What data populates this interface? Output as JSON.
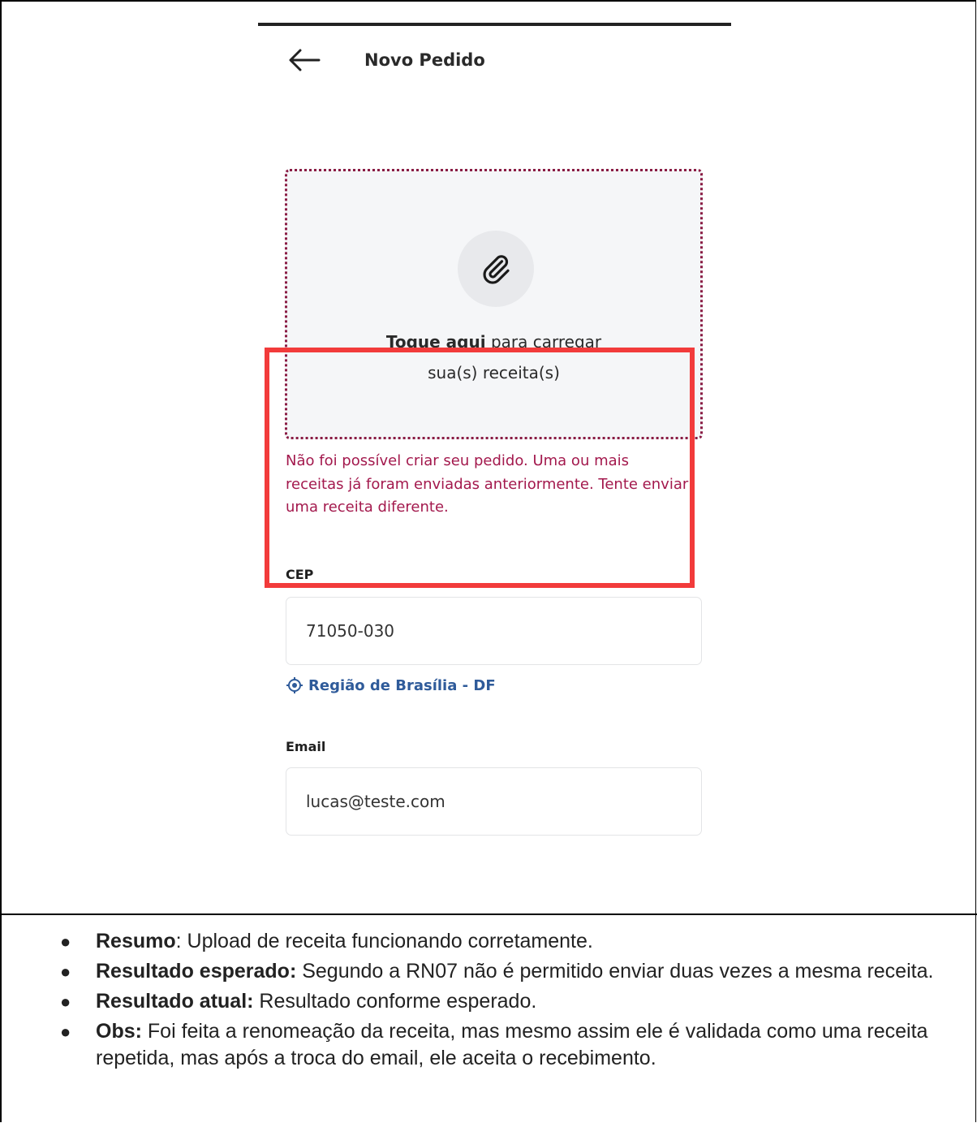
{
  "app": {
    "title": "Novo Pedido",
    "back_label": "Voltar"
  },
  "upload": {
    "bold_text": "Toque aqui",
    "text_part1": " para carregar",
    "text_part2": "sua(s) receita(s)",
    "icon": "paperclip-icon"
  },
  "error": {
    "message": "Não foi possível criar seu pedido. Uma ou mais receitas já foram enviadas anteriormente. Tente enviar uma receita diferente."
  },
  "form": {
    "cep_label": "CEP",
    "cep_value": "71050-030",
    "region_text": "Região de Brasília - DF",
    "email_label": "Email",
    "email_value": "lucas@teste.com"
  },
  "notes": [
    {
      "bold": "Resumo",
      "text": ": Upload de receita funcionando corretamente."
    },
    {
      "bold": "Resultado esperado:",
      "text": " Segundo a RN07 não é permitido enviar duas vezes a mesma receita."
    },
    {
      "bold": "Resultado atual:",
      "text": " Resultado conforme esperado."
    },
    {
      "bold": "Obs:",
      "text": " Foi feita a renomeação da receita, mas mesmo assim ele é validada como uma receita repetida, mas após a troca do email, ele aceita o recebimento."
    }
  ],
  "colors": {
    "accent_error": "#a3194d",
    "highlight_box": "#f23b3b",
    "link_blue": "#2f5b9a"
  }
}
